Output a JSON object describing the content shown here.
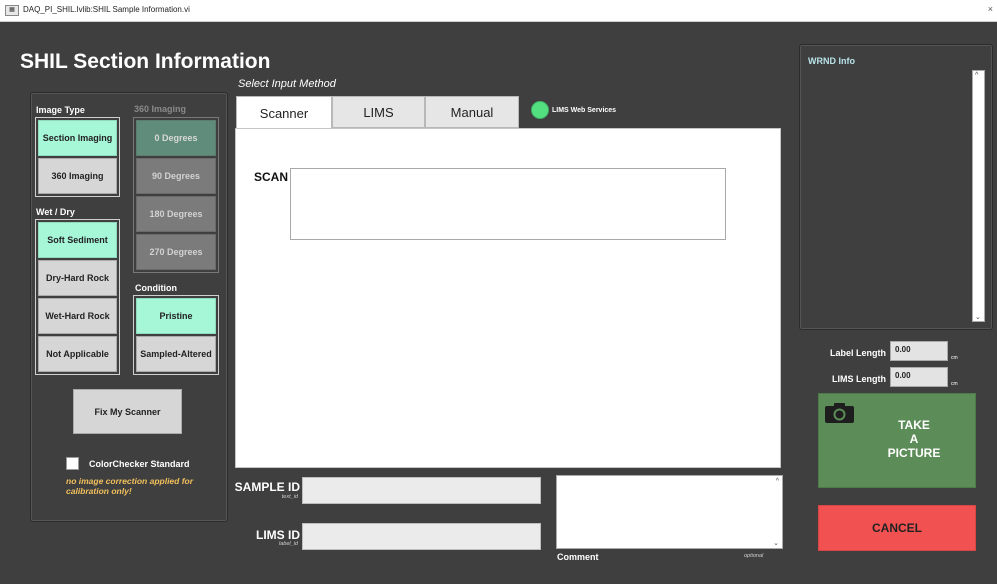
{
  "window": {
    "title": "DAQ_PI_SHIL.lvlib:SHIL Sample Information.vi",
    "close_glyph": "×"
  },
  "page_title": "SHIL Section Information",
  "left_panel": {
    "image_type": {
      "label": "Image Type",
      "options": [
        "Section Imaging",
        "360 Imaging"
      ],
      "selected": "Section Imaging"
    },
    "imaging_360": {
      "label": "360 Imaging",
      "options": [
        "0 Degrees",
        "90 Degrees",
        "180 Degrees",
        "270 Degrees"
      ],
      "selected": "0 Degrees",
      "enabled": false
    },
    "wet_dry": {
      "label": "Wet / Dry",
      "options": [
        "Soft Sediment",
        "Dry-Hard Rock",
        "Wet-Hard Rock",
        "Not Applicable"
      ],
      "selected": "Soft Sediment"
    },
    "condition": {
      "label": "Condition",
      "options": [
        "Pristine",
        "Sampled-Altered"
      ],
      "selected": "Pristine"
    },
    "fix_scanner_label": "Fix My Scanner",
    "colorchecker": {
      "label": "ColorChecker Standard",
      "checked": false,
      "note": "no image correction applied for calibration only!"
    }
  },
  "input_method": {
    "label": "Select Input Method",
    "tabs": [
      "Scanner",
      "LIMS",
      "Manual"
    ],
    "active_tab": "Scanner",
    "lims_status": {
      "label": "LIMS Web Services",
      "color": "#53e07f"
    },
    "scan_label": "SCAN",
    "scan_value": ""
  },
  "ids": {
    "sample": {
      "label": "SAMPLE ID",
      "sub": "text_id",
      "value": ""
    },
    "lims": {
      "label": "LIMS ID",
      "sub": "label_id",
      "value": ""
    }
  },
  "comment": {
    "label": "Comment",
    "optional": "optional",
    "value": ""
  },
  "wrnd": {
    "label": "WRND Info"
  },
  "lengths": {
    "label_length": {
      "label": "Label Length",
      "value": "0.00",
      "unit": "cm"
    },
    "lims_length": {
      "label": "LIMS Length",
      "value": "0.00",
      "unit": "cm"
    }
  },
  "take_picture": {
    "lines": [
      "TAKE",
      "A",
      "PICTURE"
    ],
    "color": "#5c8c57"
  },
  "cancel": {
    "label": "CANCEL",
    "color": "#f25151"
  },
  "icons": {
    "camera": "camera-icon",
    "scroll_up": "chevron-up-icon",
    "scroll_down": "chevron-down-icon"
  }
}
